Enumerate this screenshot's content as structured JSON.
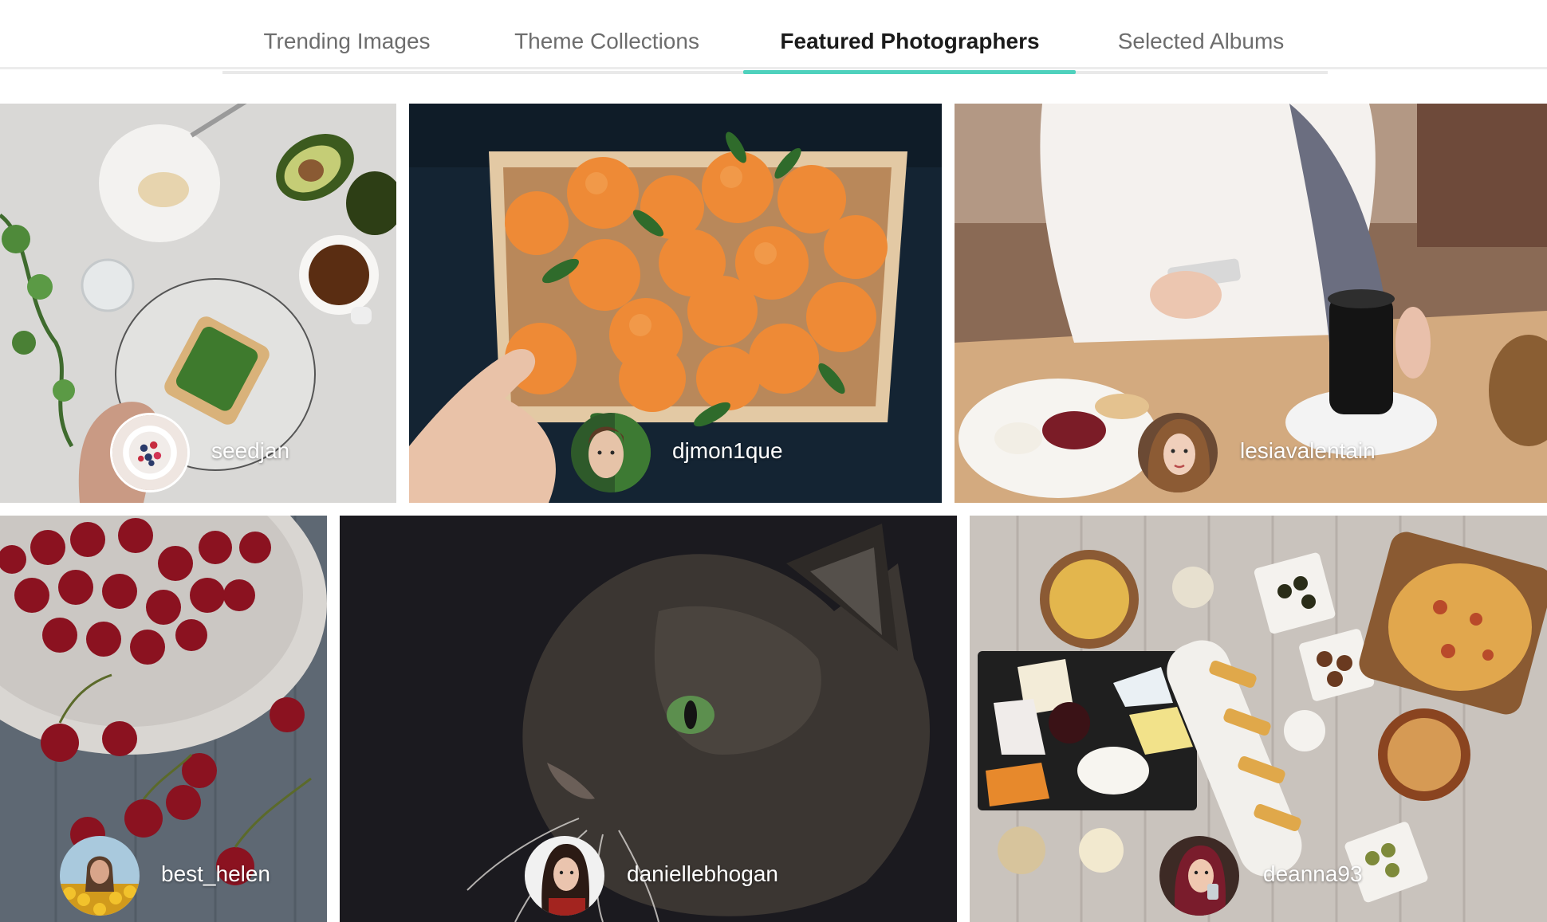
{
  "tabs": [
    {
      "label": "Trending Images",
      "active": false
    },
    {
      "label": "Theme Collections",
      "active": false
    },
    {
      "label": "Featured Photographers",
      "active": true
    },
    {
      "label": "Selected Albums",
      "active": false
    }
  ],
  "colors": {
    "accent": "#4fd1bd",
    "tab_active_text": "#1b1b1b",
    "tab_inactive_text": "#6d6d6d"
  },
  "photographers": [
    {
      "username": "seedjan",
      "photo_subject": "avocado toast breakfast"
    },
    {
      "username": "djmon1que",
      "photo_subject": "crate of tangerines"
    },
    {
      "username": "lesiavalentain",
      "photo_subject": "woman with phone and coffee"
    },
    {
      "username": "best_helen",
      "photo_subject": "cherries on plate"
    },
    {
      "username": "daniellebhogan",
      "photo_subject": "cat close-up"
    },
    {
      "username": "deanna93",
      "photo_subject": "snack board with pizza"
    }
  ]
}
